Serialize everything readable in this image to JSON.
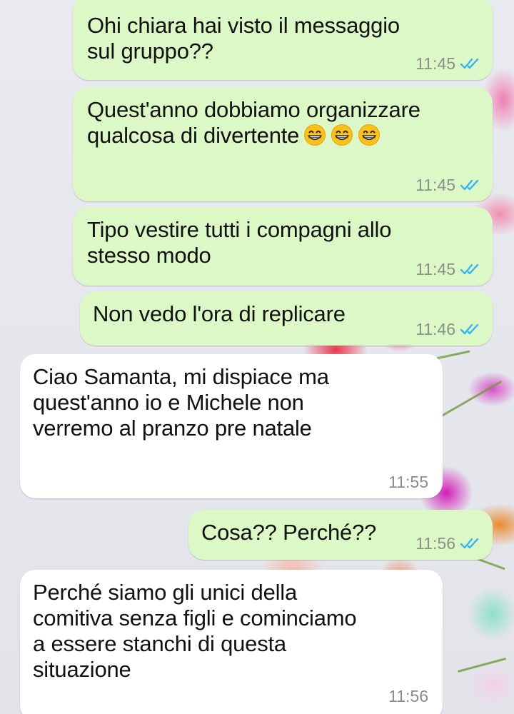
{
  "conversation": {
    "messages": [
      {
        "direction": "out",
        "text": "Ohi chiara hai visto il messaggio\nsul gruppo??",
        "time": "11:45",
        "status": "read-icon"
      },
      {
        "direction": "out",
        "text": "Quest'anno dobbiamo organizzare\nqualcosa di divertente",
        "emoji": [
          "grinning-face-icon",
          "grinning-face-icon",
          "grinning-face-icon"
        ],
        "time": "11:45",
        "status": "read-icon"
      },
      {
        "direction": "out",
        "text": "Tipo vestire tutti i compagni allo\nstesso modo",
        "time": "11:45",
        "status": "read-icon"
      },
      {
        "direction": "out",
        "text": "Non vedo l'ora di replicare",
        "time": "11:46",
        "status": "read-icon"
      },
      {
        "direction": "in",
        "text": "Ciao Samanta, mi dispiace ma\nquest'anno io e Michele non\nverremo al pranzo pre natale",
        "time": "11:55"
      },
      {
        "direction": "out",
        "text": "Cosa?? Perché??",
        "time": "11:56",
        "status": "read-icon"
      },
      {
        "direction": "in",
        "text": "Perché siamo gli unici della\ncomitiva senza figli e cominciamo\na essere stanchi di questa\nsituazione",
        "time": "11:56"
      }
    ]
  },
  "colors": {
    "outgoing_bubble": "#dcf8c6",
    "incoming_bubble": "#ffffff",
    "read_ticks": "#34b7f1",
    "timestamp": "#8a9189"
  }
}
